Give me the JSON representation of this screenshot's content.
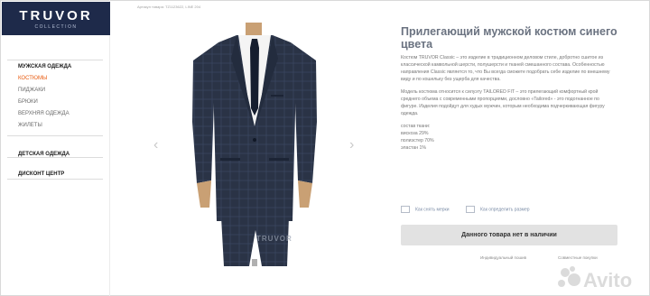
{
  "brand": {
    "name": "TRUVOR",
    "tagline": "COLLECTION"
  },
  "breadcrumb": "Артикул товара: TZ1123622, LINE 204",
  "sidebar": {
    "items": [
      {
        "label": "МУЖСКАЯ ОДЕЖДА",
        "type": "head"
      },
      {
        "label": "КОСТЮМЫ",
        "type": "active"
      },
      {
        "label": "ПИДЖАКИ",
        "type": "sub"
      },
      {
        "label": "БРЮКИ",
        "type": "sub"
      },
      {
        "label": "ВЕРХНЯЯ ОДЕЖДА",
        "type": "sub"
      },
      {
        "label": "ЖИЛЕТЫ",
        "type": "sub"
      },
      {
        "label": "ДЕТСКАЯ ОДЕЖДА",
        "type": "head"
      },
      {
        "label": "ДИСКОНТ ЦЕНТР",
        "type": "head"
      }
    ]
  },
  "gallery": {
    "prev_icon": "‹",
    "next_icon": "›",
    "watermark": "TRUVOR"
  },
  "product": {
    "title": "Прилегающий мужской костюм синего цвета",
    "paragraph1": "Костюм TRUVOR Classic – это изделие в традиционном деловом стиле, добротно сшитое из классической камвольной шерсти, полушерсти и тканей смешанного состава. Особенностью направления Classic является то, что Вы всегда сможете подобрать себе изделие по внешнему виду и по кошельку без ущерба для качества.",
    "paragraph2": "Модель костюма относится к силуэту TAILORED FIT – это прилегающий комфортный крой среднего объема с современными пропорциями, дословно «Tailored» - это подогнанное по фигуре. Изделия подойдут для худых мужчин, которым необходима подчеркивающая фигуру одежда.",
    "composition_title": "состав ткани:",
    "composition": [
      "вискоза 29%",
      "полиэстер 70%",
      "эластан 1%"
    ]
  },
  "links": {
    "measure": "Как снять мерки",
    "size": "Как определить размер"
  },
  "cta": "Данного товара нет в наличии",
  "bottom_links": {
    "tailoring": "Индивидуальный пошив",
    "together": "Совместные покупки"
  },
  "watermark": "Avito",
  "colors": {
    "logo_bg": "#1e2a4a",
    "accent": "#e8590c",
    "suit": "#2a3346"
  }
}
